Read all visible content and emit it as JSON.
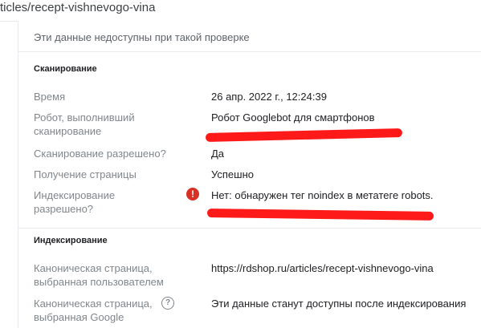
{
  "address_bar": {
    "url_fragment": "ticles/recept-vishnevogo-vina"
  },
  "notice": {
    "text": "Эти данные недоступны при такой проверке"
  },
  "crawl_section": {
    "title": "Сканирование",
    "rows": [
      {
        "label": "Время",
        "value": "26 апр. 2022 г., 12:24:39"
      },
      {
        "label": "Робот, выполнивший сканирование",
        "value": "Робот Googlebot для смартфонов"
      },
      {
        "label": "Сканирование разрешено?",
        "value": "Да"
      },
      {
        "label": "Получение страницы",
        "value": "Успешно"
      },
      {
        "label": "Индексирование разрешено?",
        "value": "Нет: обнаружен тег noindex в метатеге robots.",
        "status": "error",
        "icon": "error-icon"
      }
    ]
  },
  "index_section": {
    "title": "Индексирование",
    "rows": [
      {
        "label": "Каноническая страница, выбранная пользователем",
        "value": "https://rdshop.ru/articles/recept-vishnevogo-vina"
      },
      {
        "label": "Каноническая страница, выбранная Google",
        "value": "Эти данные станут доступны после индексирования",
        "icon": "help-icon"
      }
    ]
  },
  "colors": {
    "error": "#d93025",
    "redaction_marks": "#ff1a1a",
    "label_text": "#80868b"
  }
}
